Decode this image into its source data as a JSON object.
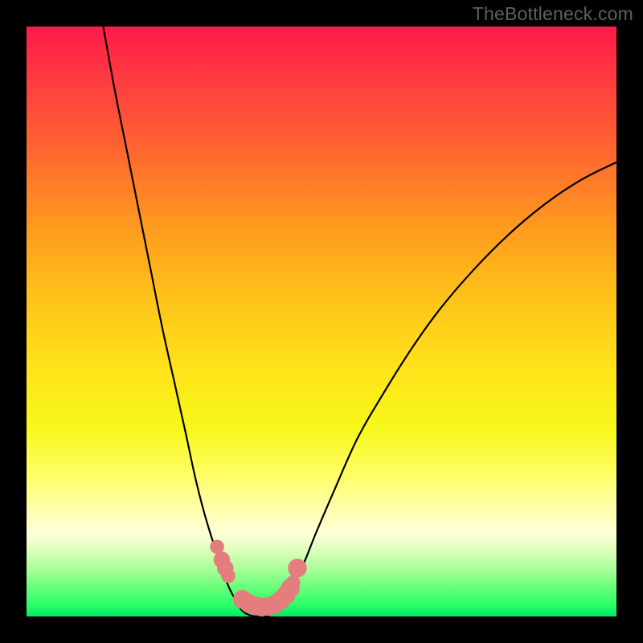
{
  "watermark": "TheBottleneck.com",
  "chart_data": {
    "type": "line",
    "title": "",
    "xlabel": "",
    "ylabel": "",
    "xlim": [
      0,
      100
    ],
    "ylim": [
      0,
      100
    ],
    "series": [
      {
        "name": "left-curve",
        "x": [
          13,
          15,
          17,
          19,
          21,
          23,
          25,
          27,
          28.5,
          30,
          31.5,
          33,
          34.2,
          35.3,
          36.2,
          37
        ],
        "y": [
          100,
          89,
          79,
          69,
          59,
          49,
          40,
          31,
          24,
          18,
          13,
          8.5,
          5.2,
          3,
          1.4,
          0.6
        ]
      },
      {
        "name": "right-curve",
        "x": [
          42,
          43.5,
          45,
          47,
          49,
          52,
          56,
          60,
          65,
          70,
          76,
          82,
          88,
          94,
          100
        ],
        "y": [
          0.6,
          2.3,
          5,
          9,
          14,
          21,
          30,
          37,
          45,
          52,
          59,
          65,
          70,
          74,
          77
        ]
      },
      {
        "name": "bottom-arc",
        "x": [
          37,
          38,
          39,
          40,
          41,
          42
        ],
        "y": [
          0.6,
          0.15,
          0.02,
          0.02,
          0.15,
          0.6
        ]
      }
    ],
    "markers": {
      "name": "highlighted-points",
      "color": "#e47d7d",
      "points": [
        {
          "x": 32.3,
          "y": 11.8,
          "r": 1.2
        },
        {
          "x": 33.1,
          "y": 9.6,
          "r": 1.4
        },
        {
          "x": 33.7,
          "y": 8.2,
          "r": 1.4
        },
        {
          "x": 34.2,
          "y": 6.9,
          "r": 1.2
        },
        {
          "x": 36.6,
          "y": 2.9,
          "r": 1.6
        },
        {
          "x": 37.7,
          "y": 2.2,
          "r": 1.6
        },
        {
          "x": 38.8,
          "y": 1.8,
          "r": 1.6
        },
        {
          "x": 39.9,
          "y": 1.6,
          "r": 1.6
        },
        {
          "x": 41.0,
          "y": 1.7,
          "r": 1.6
        },
        {
          "x": 42.1,
          "y": 2.1,
          "r": 1.6
        },
        {
          "x": 43.1,
          "y": 2.8,
          "r": 1.6
        },
        {
          "x": 44.0,
          "y": 3.7,
          "r": 1.6
        },
        {
          "x": 44.7,
          "y": 4.8,
          "r": 1.6
        },
        {
          "x": 45.2,
          "y": 5.8,
          "r": 1.2
        },
        {
          "x": 45.9,
          "y": 8.2,
          "r": 1.6
        }
      ]
    },
    "gradient_stops": [
      {
        "pos": 0,
        "color": "#ff1a4a"
      },
      {
        "pos": 50,
        "color": "#ffe31a"
      },
      {
        "pos": 88,
        "color": "#ffffd0"
      },
      {
        "pos": 100,
        "color": "#00e865"
      }
    ]
  }
}
